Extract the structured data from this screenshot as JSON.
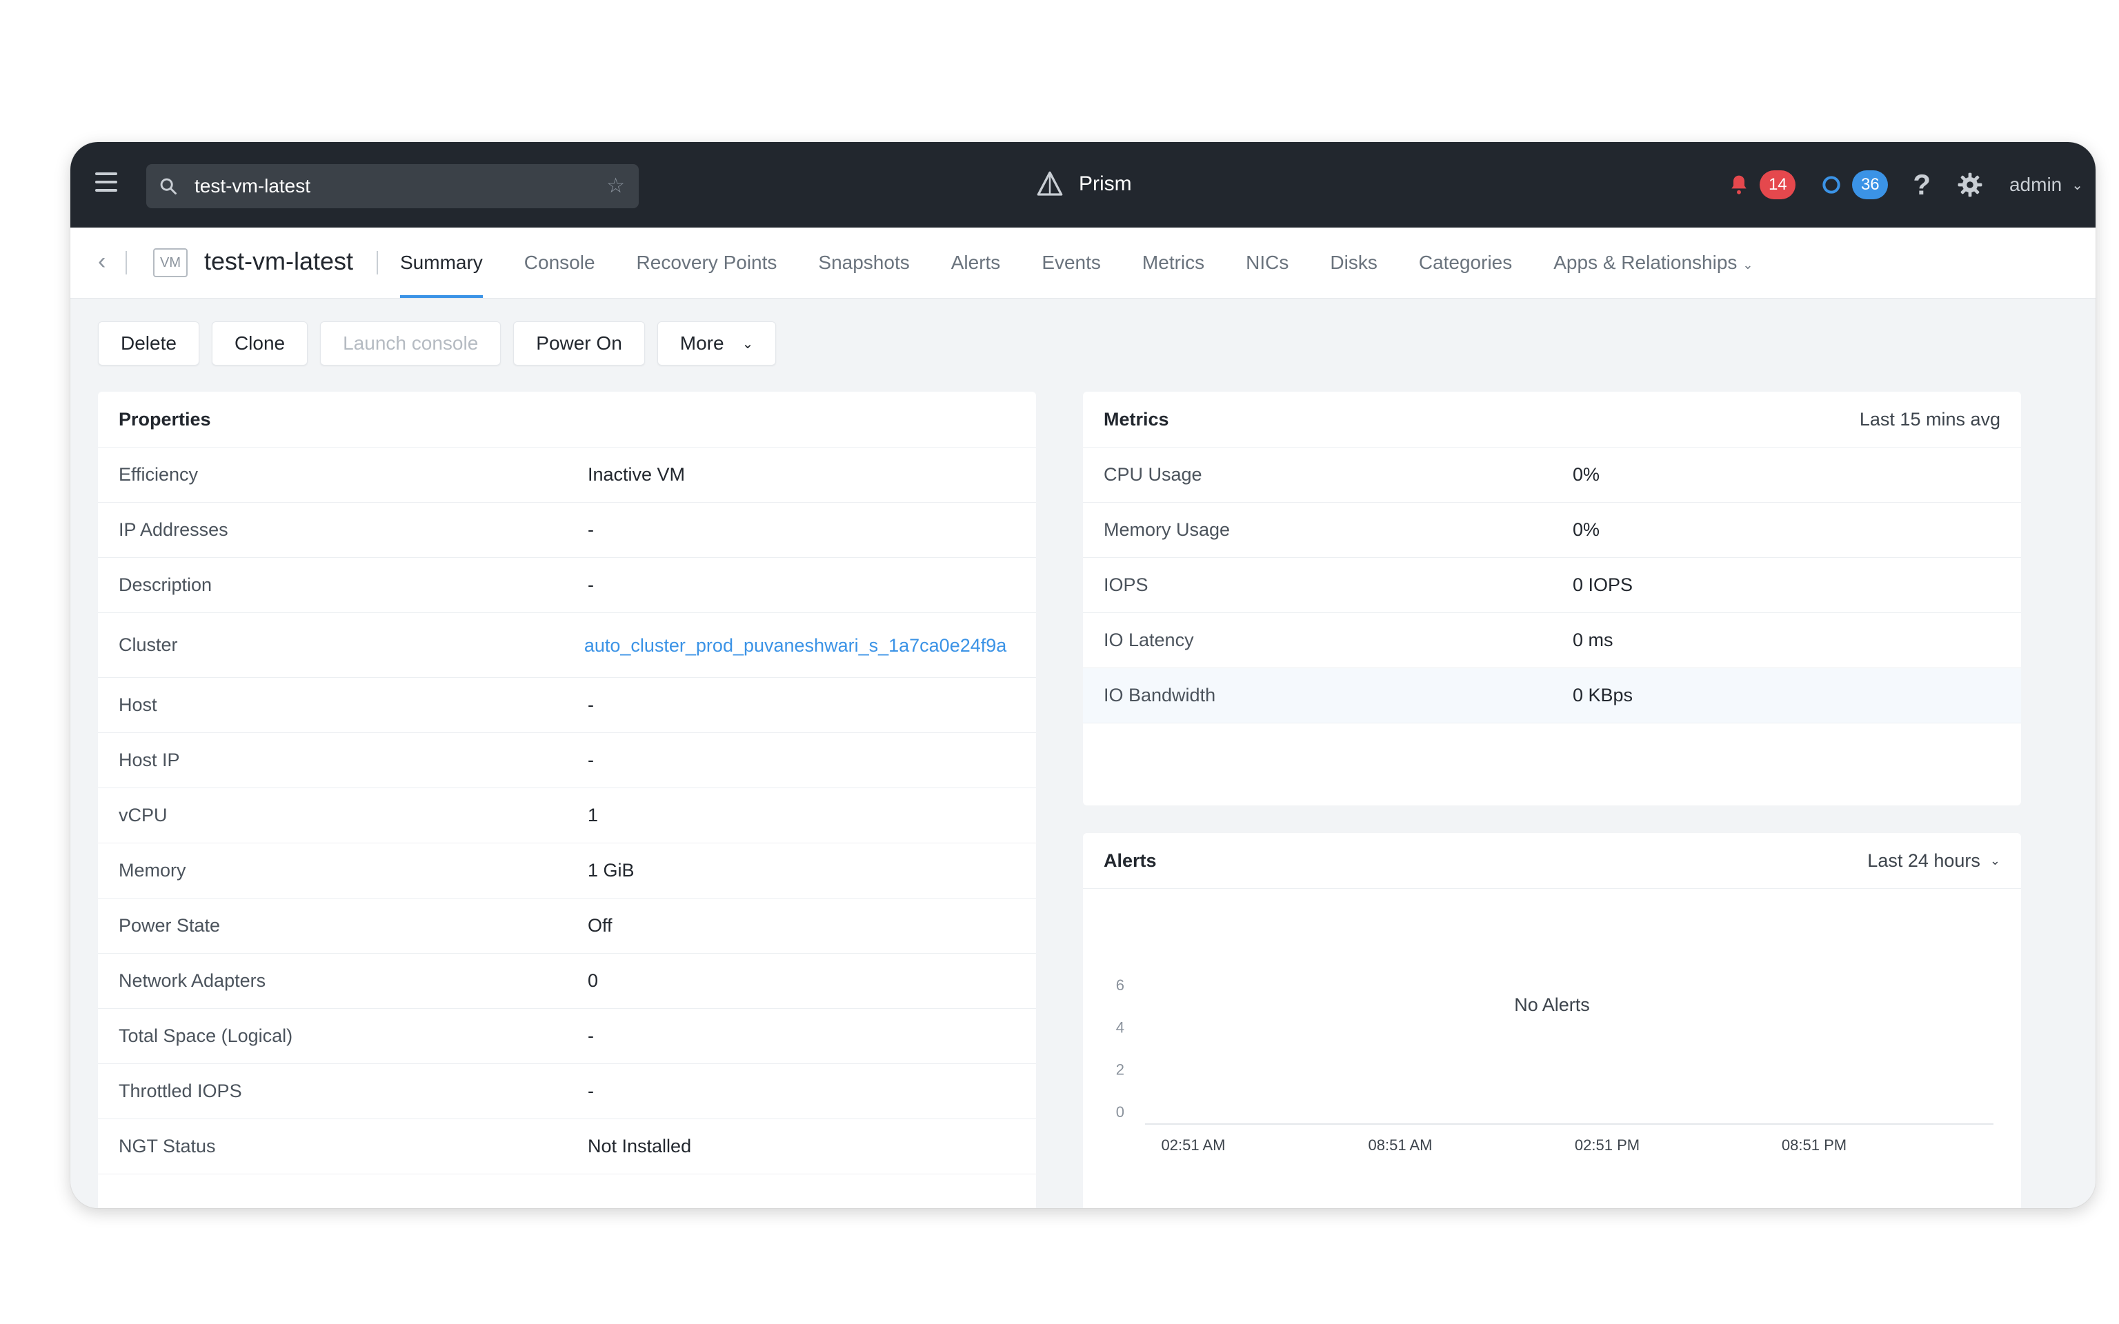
{
  "search": {
    "value": "test-vm-latest"
  },
  "brand": {
    "name": "Prism"
  },
  "topbar": {
    "alerts_count": "14",
    "tasks_count": "36",
    "user": "admin"
  },
  "header": {
    "vm_badge": "VM",
    "vm_name": "test-vm-latest"
  },
  "tabs": [
    {
      "label": "Summary",
      "active": true
    },
    {
      "label": "Console"
    },
    {
      "label": "Recovery Points"
    },
    {
      "label": "Snapshots"
    },
    {
      "label": "Alerts"
    },
    {
      "label": "Events"
    },
    {
      "label": "Metrics"
    },
    {
      "label": "NICs"
    },
    {
      "label": "Disks"
    },
    {
      "label": "Categories"
    },
    {
      "label": "Apps & Relationships"
    }
  ],
  "actions": {
    "delete": "Delete",
    "clone": "Clone",
    "launch_console": "Launch console",
    "power_on": "Power On",
    "more": "More"
  },
  "properties": {
    "title": "Properties",
    "rows": [
      {
        "key": "Efficiency",
        "value": "Inactive VM"
      },
      {
        "key": "IP Addresses",
        "value": "-"
      },
      {
        "key": "Description",
        "value": "-"
      },
      {
        "key": "Cluster",
        "value": "auto_cluster_prod_puvaneshwari_s_1a7ca0e24f9a"
      },
      {
        "key": "Host",
        "value": "-"
      },
      {
        "key": "Host IP",
        "value": "-"
      },
      {
        "key": "vCPU",
        "value": "1"
      },
      {
        "key": "Memory",
        "value": "1 GiB"
      },
      {
        "key": "Power State",
        "value": "Off"
      },
      {
        "key": "Network Adapters",
        "value": "0"
      },
      {
        "key": "Total Space (Logical)",
        "value": "-"
      },
      {
        "key": "Throttled IOPS",
        "value": "-"
      },
      {
        "key": "NGT Status",
        "value": "Not Installed"
      }
    ]
  },
  "metrics": {
    "title": "Metrics",
    "period": "Last 15 mins avg",
    "rows": [
      {
        "key": "CPU Usage",
        "value": "0%"
      },
      {
        "key": "Memory Usage",
        "value": "0%"
      },
      {
        "key": "IOPS",
        "value": "0 IOPS"
      },
      {
        "key": "IO Latency",
        "value": "0 ms"
      },
      {
        "key": "IO Bandwidth",
        "value": "0 KBps"
      }
    ]
  },
  "alerts_panel": {
    "title": "Alerts",
    "period": "Last 24 hours",
    "empty_text": "No Alerts"
  },
  "chart_data": {
    "type": "line",
    "x": [
      "02:51 AM",
      "08:51 AM",
      "02:51 PM",
      "08:51 PM"
    ],
    "yticks": [
      0,
      2,
      4,
      6
    ],
    "ylim": [
      0,
      6
    ],
    "series": [],
    "grid": false
  },
  "colors": {
    "accent": "#3b93e6",
    "topbar": "#22272e",
    "alert_red": "#e5484d"
  }
}
